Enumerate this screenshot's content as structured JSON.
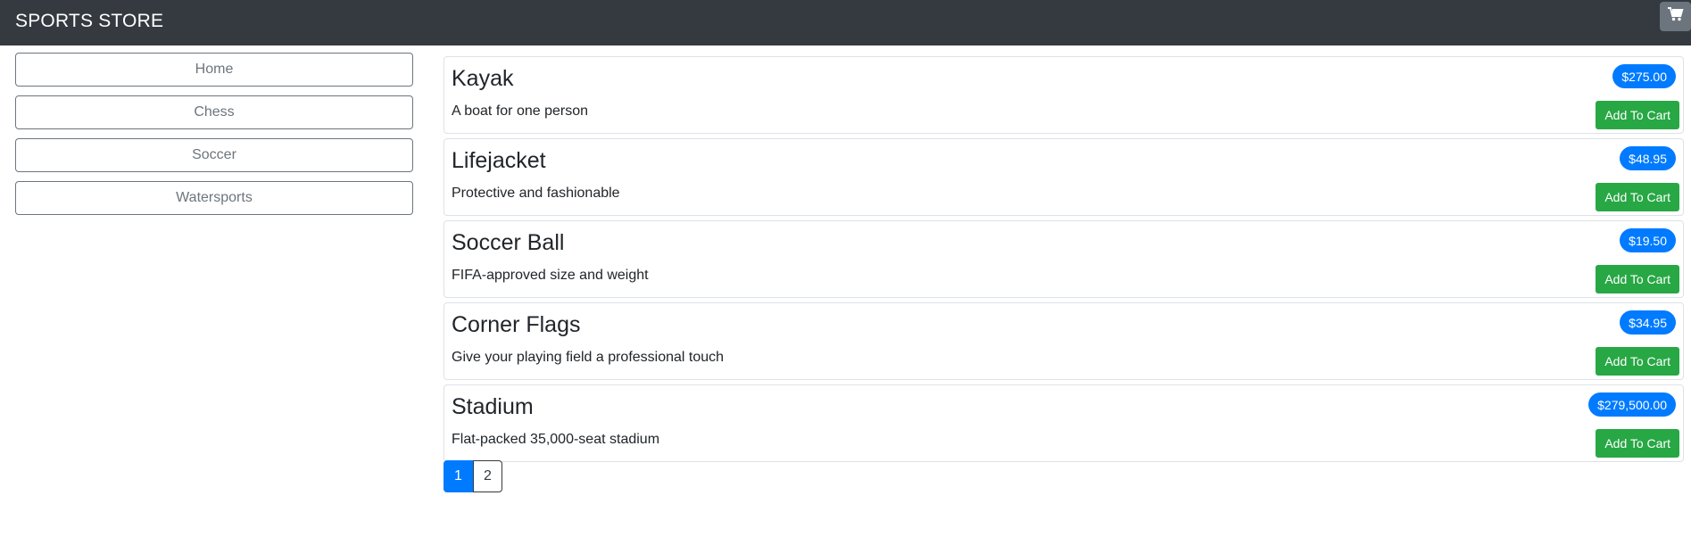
{
  "navbar": {
    "brand": "SPORTS STORE",
    "cart_icon": "cart-icon"
  },
  "sidebar": {
    "items": [
      {
        "label": "Home"
      },
      {
        "label": "Chess"
      },
      {
        "label": "Soccer"
      },
      {
        "label": "Watersports"
      }
    ]
  },
  "products": [
    {
      "name": "Kayak",
      "description": "A boat for one person",
      "price": "$275.00",
      "button": "Add To Cart"
    },
    {
      "name": "Lifejacket",
      "description": "Protective and fashionable",
      "price": "$48.95",
      "button": "Add To Cart"
    },
    {
      "name": "Soccer Ball",
      "description": "FIFA-approved size and weight",
      "price": "$19.50",
      "button": "Add To Cart"
    },
    {
      "name": "Corner Flags",
      "description": "Give your playing field a professional touch",
      "price": "$34.95",
      "button": "Add To Cart"
    },
    {
      "name": "Stadium",
      "description": "Flat-packed 35,000-seat stadium",
      "price": "$279,500.00",
      "button": "Add To Cart"
    }
  ],
  "pagination": {
    "pages": [
      "1",
      "2"
    ],
    "current": "1"
  },
  "colors": {
    "navbar": "#343a40",
    "price_badge": "#007bff",
    "add_button": "#28a745",
    "cart_button": "#6c757d"
  }
}
